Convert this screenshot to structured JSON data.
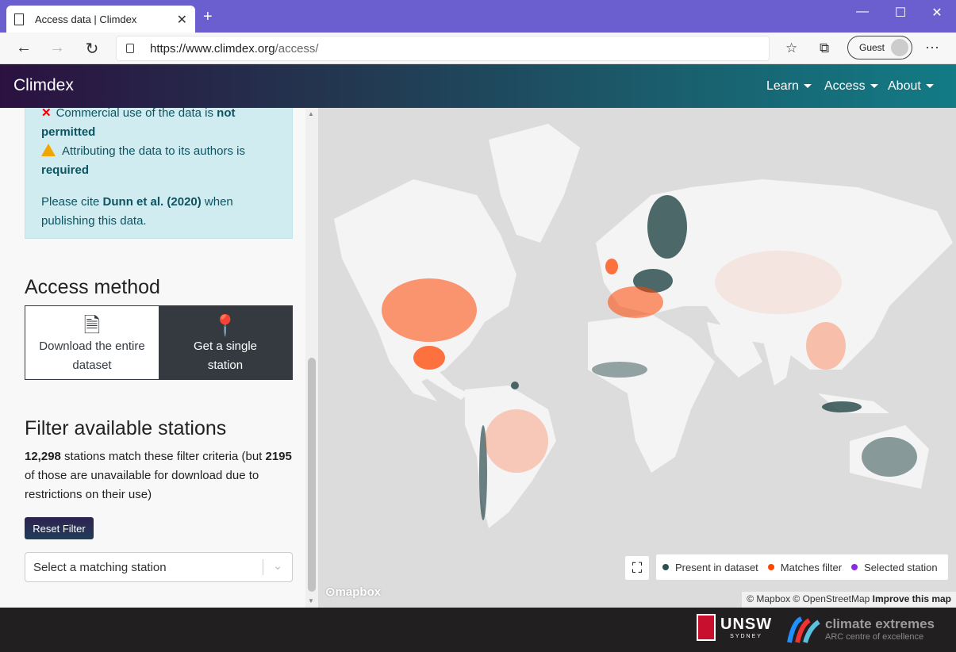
{
  "browser": {
    "tab_title": "Access data | Climdex",
    "url_domain": "https://www.climdex.org",
    "url_path": "/access/",
    "profile_label": "Guest"
  },
  "nav": {
    "brand": "Climdex",
    "links": [
      "Learn",
      "Access",
      "About"
    ]
  },
  "license_box": {
    "line1_prefix": "Commercial use of the data is ",
    "line1_bold": "not",
    "line1_bold2": "permitted",
    "line2_prefix": "Attributing the data to its authors is",
    "line2_bold": "required",
    "cite_prefix": "Please cite ",
    "cite_bold": "Dunn et al. (2020)",
    "cite_suffix": " when publishing this data."
  },
  "access_method": {
    "heading": "Access method",
    "options": [
      {
        "label": "Download the entire dataset",
        "icon": "zip-file-icon",
        "active": false
      },
      {
        "label": "Get a single station",
        "icon": "map-pin-icon",
        "active": true
      }
    ]
  },
  "filter": {
    "heading": "Filter available stations",
    "count_bold": "12,298",
    "count_text": " stations match these filter criteria (but ",
    "unavailable_bold": "2195",
    "unavailable_text": " of those are unavailable for download due to restrictions on their use)",
    "reset_label": "Reset Filter",
    "select_placeholder": "Select a matching station"
  },
  "map": {
    "legend": [
      {
        "label": "Present in dataset",
        "color": "#2f4f4f"
      },
      {
        "label": "Matches filter",
        "color": "#ff4500"
      },
      {
        "label": "Selected station",
        "color": "#8a2be2"
      }
    ],
    "logo_text": "mapbox",
    "attribution": "© Mapbox © OpenStreetMap",
    "improve_link": "Improve this map"
  },
  "footer": {
    "unsw_text": "UNSW",
    "unsw_sub": "SYDNEY",
    "cex_title": "climate extremes",
    "cex_sub": "ARC centre of excellence"
  },
  "colors": {
    "accent": "#343a40",
    "info_bg": "#d1ecf1",
    "match": "#ff4500",
    "present": "#2f4f4f"
  }
}
